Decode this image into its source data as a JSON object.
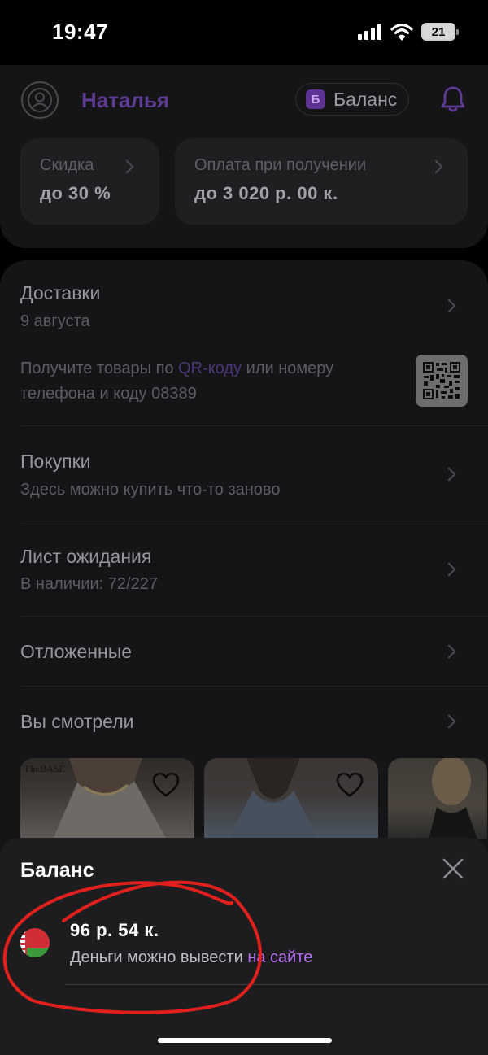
{
  "status_bar": {
    "time": "19:47",
    "battery": "21",
    "icons": [
      "cellular-signal-icon",
      "wifi-icon",
      "battery-icon"
    ]
  },
  "header": {
    "user_name": "Наталья",
    "balance_badge": "Б",
    "balance_label": "Баланс",
    "cards": [
      {
        "title": "Скидка",
        "value": "до 30 %"
      },
      {
        "title": "Оплата при получении",
        "value": "до 3 020 р.  00 к."
      }
    ]
  },
  "menu": {
    "deliveries": {
      "title": "Доставки",
      "date": "9 августа",
      "qr_text_before": "Получите товары по ",
      "qr_link": "QR-коду",
      "qr_text_after": " или номеру телефона и коду 08389"
    },
    "purchases": {
      "title": "Покупки",
      "subtitle": "Здесь можно купить что-то заново"
    },
    "waitlist": {
      "title": "Лист ожидания",
      "subtitle": "В наличии: 72/227"
    },
    "postponed": {
      "title": "Отложенные"
    },
    "viewed": {
      "title": "Вы смотрели",
      "thumb_brand": "TheBASE"
    }
  },
  "sheet": {
    "title": "Баланс",
    "amount": "96 р.  54 к.",
    "note_before": "Деньги можно вывести ",
    "note_link": "на сайте",
    "flag_icon": "belarus-flag-icon"
  },
  "colors": {
    "accent_purple": "#5d3b93",
    "link_purple": "#b66cf4",
    "annotation_red": "#e0201c"
  }
}
